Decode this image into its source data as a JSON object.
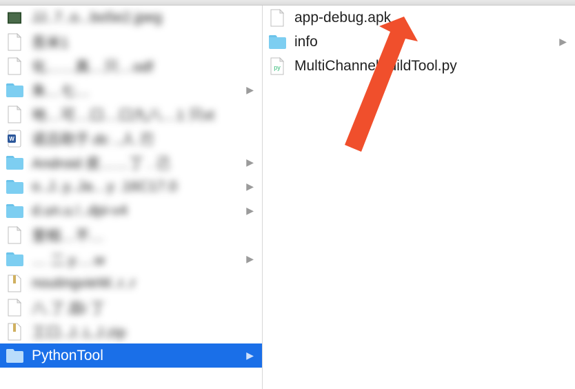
{
  "left_column": {
    "items": [
      {
        "label": "JJ..7..o...bo5e2.jpeg",
        "type": "image",
        "has_children": false,
        "blurred": true
      },
      {
        "label": "吾米1",
        "type": "blank-file",
        "has_children": false,
        "blurred": true
      },
      {
        "label": "化……真…只…odf",
        "type": "blank-file",
        "has_children": false,
        "blurred": true
      },
      {
        "label": "朱…七…",
        "type": "folder",
        "has_children": true,
        "blurred": true
      },
      {
        "label": "地…可…口…口九八…1 只xt",
        "type": "blank-file",
        "has_children": false,
        "blurred": true
      },
      {
        "label": "诺吕助于.dc ..人 刃",
        "type": "docx",
        "has_children": false,
        "blurred": true
      },
      {
        "label": "Android 皮……丁 . 己",
        "type": "folder",
        "has_children": true,
        "blurred": true
      },
      {
        "label": "o..J..y..Ja…y .16C17.0",
        "type": "folder",
        "has_children": true,
        "blurred": true
      },
      {
        "label": "d.un.u.!..dpi-v4",
        "type": "folder",
        "has_children": true,
        "blurred": true
      },
      {
        "label": "里相…不…",
        "type": "blank-file",
        "has_children": false,
        "blurred": true
      },
      {
        "label": "… 二.y….w",
        "type": "folder",
        "has_children": true,
        "blurred": true
      },
      {
        "label": "noutingvieW..r..r",
        "type": "jar",
        "has_children": false,
        "blurred": true
      },
      {
        "label": "八.了.皿i 丁",
        "type": "blank-file",
        "has_children": false,
        "blurred": true
      },
      {
        "label": "工口..J..L.J.zip",
        "type": "zip",
        "has_children": false,
        "blurred": true
      },
      {
        "label": "PythonTool",
        "type": "folder",
        "has_children": true,
        "blurred": false,
        "selected": true
      }
    ]
  },
  "right_column": {
    "items": [
      {
        "label": "app-debug.apk",
        "type": "blank-file",
        "has_children": false
      },
      {
        "label": "info",
        "type": "folder",
        "has_children": true
      },
      {
        "label": "MultiChannelBuildTool.py",
        "type": "py-file",
        "has_children": false
      }
    ]
  },
  "icon_colors": {
    "folder_fill": "#7dcef1",
    "folder_tab": "#6bc3ea",
    "selected_folder_fill": "#b9dcfb",
    "file_stroke": "#bfbfbf",
    "docx_fill": "#2b579a",
    "arrow": "#f04f2c"
  }
}
